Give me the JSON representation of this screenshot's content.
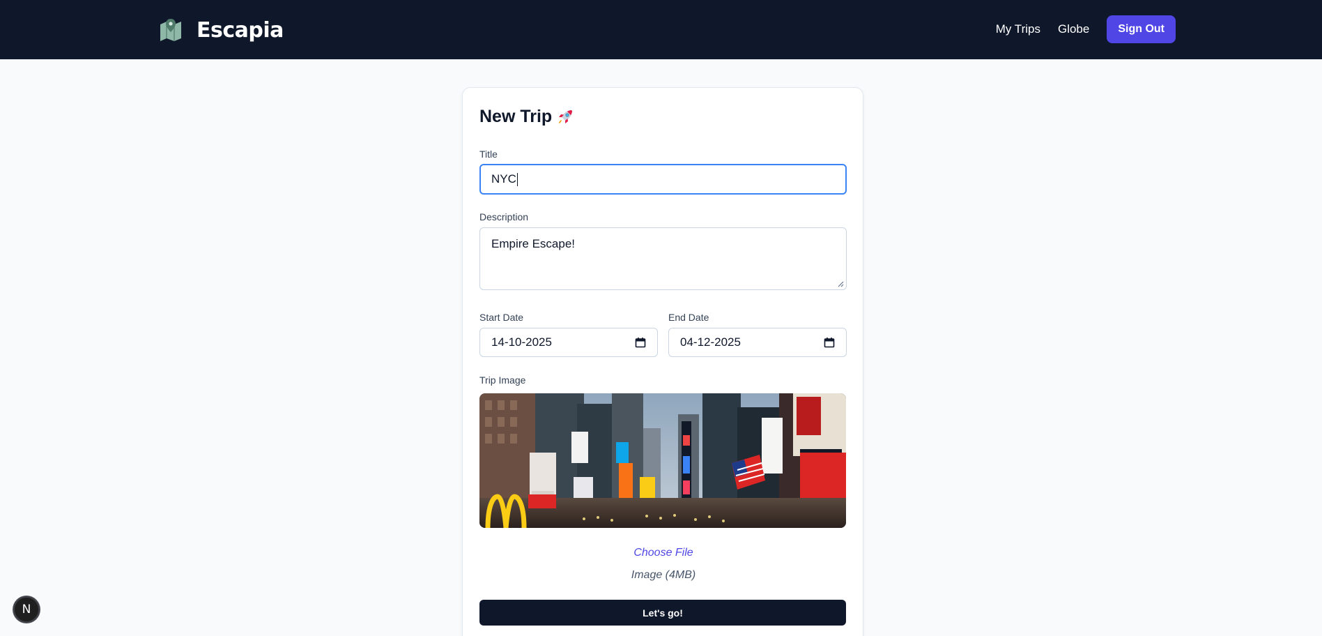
{
  "header": {
    "brand_name": "Escapia",
    "brand_icon": "map-pin-icon",
    "nav": [
      {
        "label": "My Trips"
      },
      {
        "label": "Globe"
      }
    ],
    "sign_out_label": "Sign Out"
  },
  "form": {
    "title": "New Trip",
    "title_icon": "rocket-icon",
    "title_field": {
      "label": "Title",
      "value": "NYC"
    },
    "description_field": {
      "label": "Description",
      "value": "Empire Escape!"
    },
    "start_date": {
      "label": "Start Date",
      "value": "14-10-2025"
    },
    "end_date": {
      "label": "End Date",
      "value": "04-12-2025"
    },
    "image_field": {
      "label": "Trip Image",
      "image": "times-square-photo"
    },
    "choose_file_label": "Choose File",
    "file_hint": "Image (4MB)",
    "submit_label": "Let's go!"
  },
  "dev_badge": {
    "label": "N"
  },
  "colors": {
    "navbar": "#0f172a",
    "accent": "#4f46e5",
    "background": "#f8fafc",
    "focus": "#3b82f6"
  }
}
